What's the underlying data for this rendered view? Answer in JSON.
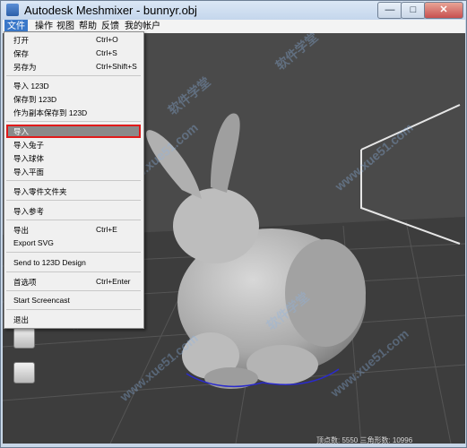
{
  "window": {
    "title": "Autodesk Meshmixer - bunnyr.obj",
    "controls": {
      "minimize": "—",
      "maximize": "□",
      "close": "✕"
    }
  },
  "menubar": {
    "items": [
      {
        "label": "文件",
        "active": true
      },
      {
        "label": "操作"
      },
      {
        "label": "视图"
      },
      {
        "label": "帮助"
      },
      {
        "label": "反馈"
      },
      {
        "label": "我的帐户"
      }
    ]
  },
  "file_menu": {
    "items": [
      {
        "label": "打开",
        "shortcut": "Ctrl+O"
      },
      {
        "label": "保存",
        "shortcut": "Ctrl+S"
      },
      {
        "label": "另存为",
        "shortcut": "Ctrl+Shift+S"
      },
      {
        "label": "导入 123D",
        "shortcut": ""
      },
      {
        "label": "保存到 123D",
        "shortcut": ""
      },
      {
        "label": "作为副本保存到 123D",
        "shortcut": ""
      },
      {
        "label": "导入",
        "shortcut": "",
        "highlighted": true
      },
      {
        "label": "导入兔子",
        "shortcut": ""
      },
      {
        "label": "导入球体",
        "shortcut": ""
      },
      {
        "label": "导入平面",
        "shortcut": ""
      },
      {
        "label": "导入零件文件夹",
        "shortcut": ""
      },
      {
        "label": "导入参考",
        "shortcut": ""
      },
      {
        "label": "导出",
        "shortcut": "Ctrl+E"
      },
      {
        "label": "Export SVG",
        "shortcut": ""
      },
      {
        "label": "Send to 123D Design",
        "shortcut": ""
      },
      {
        "label": "首选项",
        "shortcut": "Ctrl+Enter"
      },
      {
        "label": "Start Screencast",
        "shortcut": ""
      },
      {
        "label": "退出",
        "shortcut": ""
      }
    ]
  },
  "statusbar": {
    "text": "顶点数: 5550 三角形数: 10996"
  },
  "watermark": {
    "text_cn": "软件学堂",
    "text_url": "www.xue51.com"
  },
  "colors": {
    "menu_active": "#3a78c9",
    "highlight_border": "#e01a1a",
    "highlight_fill": "#8a8a8a",
    "viewport_bg": "#3b3b3b",
    "model_boundary": "#2a2acc"
  },
  "icons": [
    "app-icon",
    "import-icon",
    "export-icon"
  ]
}
